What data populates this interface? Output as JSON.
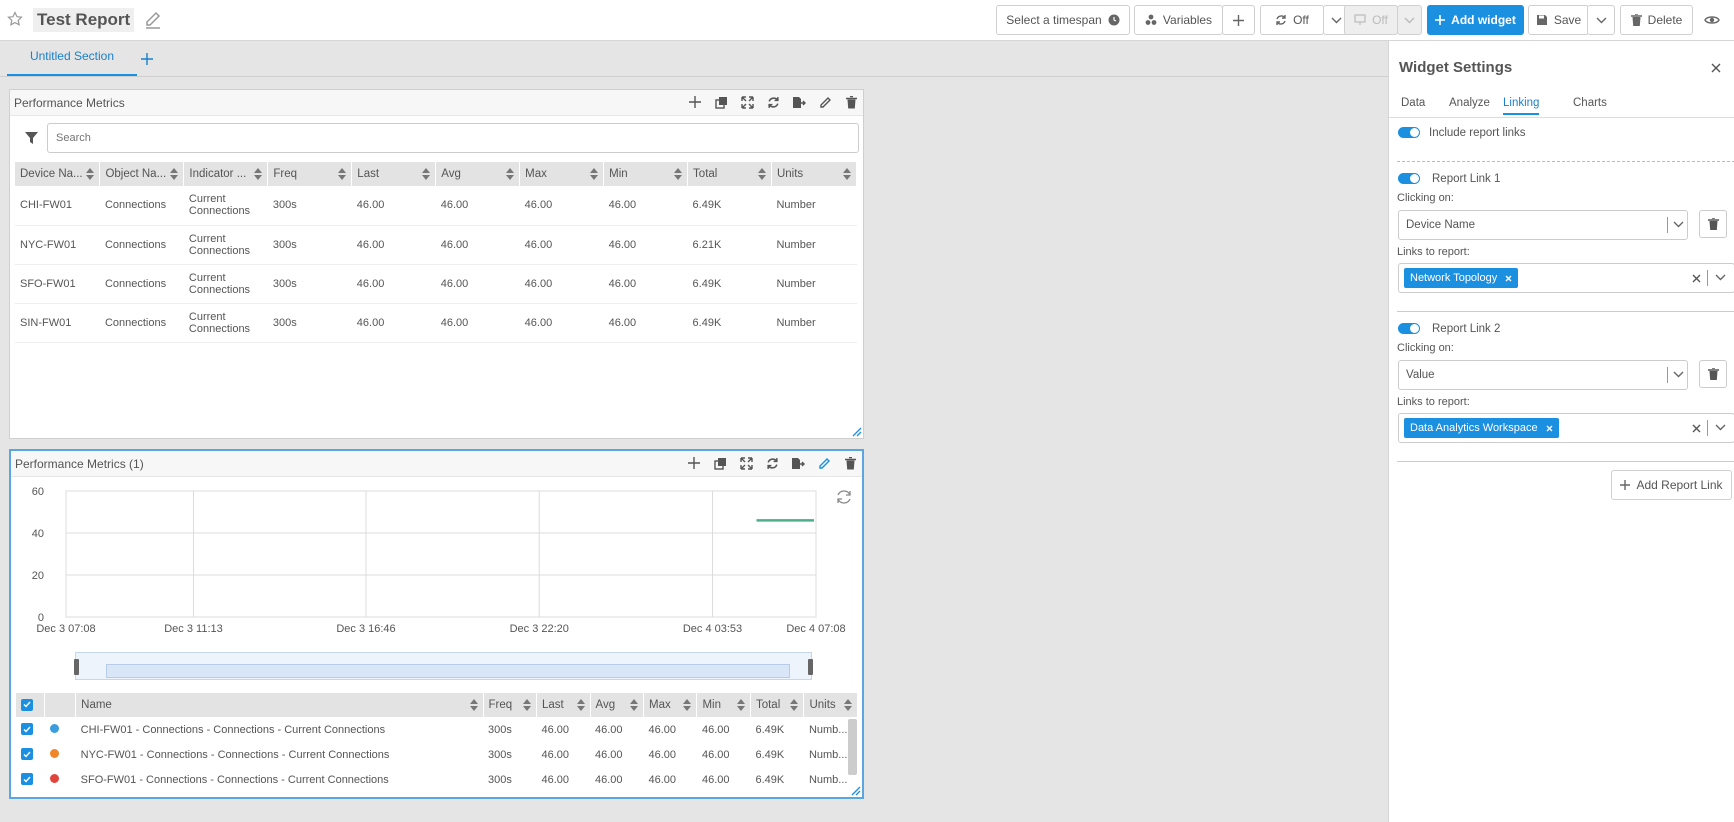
{
  "header": {
    "report_title": "Test Report",
    "timespan_label": "Select a timespan",
    "variables_label": "Variables",
    "refresh_label": "Off",
    "present_label": "Off",
    "add_widget_label": "Add widget",
    "save_label": "Save",
    "delete_label": "Delete"
  },
  "sections": {
    "tabs": [
      {
        "label": "Untitled Section"
      }
    ]
  },
  "widget1": {
    "title": "Performance Metrics",
    "search_placeholder": "Search",
    "columns": [
      "Device Na...",
      "Object Na...",
      "Indicator ...",
      "Freq",
      "Last",
      "Avg",
      "Max",
      "Min",
      "Total",
      "Units"
    ],
    "rows": [
      {
        "device": "CHI-FW01",
        "object": "Connections",
        "indicator": "Current Connections",
        "freq": "300s",
        "last": "46.00",
        "avg": "46.00",
        "max": "46.00",
        "min": "46.00",
        "total": "6.49K",
        "units": "Number"
      },
      {
        "device": "NYC-FW01",
        "object": "Connections",
        "indicator": "Current Connections",
        "freq": "300s",
        "last": "46.00",
        "avg": "46.00",
        "max": "46.00",
        "min": "46.00",
        "total": "6.21K",
        "units": "Number"
      },
      {
        "device": "SFO-FW01",
        "object": "Connections",
        "indicator": "Current Connections",
        "freq": "300s",
        "last": "46.00",
        "avg": "46.00",
        "max": "46.00",
        "min": "46.00",
        "total": "6.49K",
        "units": "Number"
      },
      {
        "device": "SIN-FW01",
        "object": "Connections",
        "indicator": "Current Connections",
        "freq": "300s",
        "last": "46.00",
        "avg": "46.00",
        "max": "46.00",
        "min": "46.00",
        "total": "6.49K",
        "units": "Number"
      }
    ]
  },
  "widget2": {
    "title": "Performance Metrics (1)",
    "legend_columns": [
      "Name",
      "Freq",
      "Last",
      "Avg",
      "Max",
      "Min",
      "Total",
      "Units"
    ],
    "legend_rows": [
      {
        "name": "CHI-FW01 - Connections - Connections - Current Connections",
        "color": "#3b9de0",
        "freq": "300s",
        "last": "46.00",
        "avg": "46.00",
        "max": "46.00",
        "min": "46.00",
        "total": "6.49K",
        "units": "Numb..."
      },
      {
        "name": "NYC-FW01 - Connections - Connections - Current Connections",
        "color": "#f0862a",
        "freq": "300s",
        "last": "46.00",
        "avg": "46.00",
        "max": "46.00",
        "min": "46.00",
        "total": "6.49K",
        "units": "Numb..."
      },
      {
        "name": "SFO-FW01 - Connections - Connections - Current Connections",
        "color": "#e0443a",
        "freq": "300s",
        "last": "46.00",
        "avg": "46.00",
        "max": "46.00",
        "min": "46.00",
        "total": "6.49K",
        "units": "Numb..."
      }
    ]
  },
  "chart_data": {
    "type": "line",
    "x_ticks": [
      "Dec 3 07:08",
      "Dec 3 11:13",
      "Dec 3 16:46",
      "Dec 3 22:20",
      "Dec 4 03:53",
      "Dec 4 07:08"
    ],
    "y_ticks": [
      0,
      20,
      40,
      60
    ],
    "ylim": [
      0,
      60
    ],
    "grid": true,
    "series": [
      {
        "color": "#4caf8a",
        "x": [
          "Dec 4 03:53",
          "Dec 4 07:08"
        ],
        "values": [
          46,
          46
        ]
      }
    ]
  },
  "panel": {
    "title": "Widget Settings",
    "tabs": [
      "Data",
      "Analyze",
      "Linking",
      "Charts"
    ],
    "active_tab": "Linking",
    "include_links_label": "Include report links",
    "links": [
      {
        "title": "Report Link 1",
        "clicking_on_label": "Clicking on:",
        "clicking_on_value": "Device Name",
        "links_to_label": "Links to report:",
        "report_chip": "Network Topology"
      },
      {
        "title": "Report Link 2",
        "clicking_on_label": "Clicking on:",
        "clicking_on_value": "Value",
        "links_to_label": "Links to report:",
        "report_chip": "Data Analytics Workspace"
      }
    ],
    "add_link_label": "Add Report Link"
  },
  "colors": {
    "accent": "#1b8fe0",
    "link": "#1b7fc9"
  }
}
